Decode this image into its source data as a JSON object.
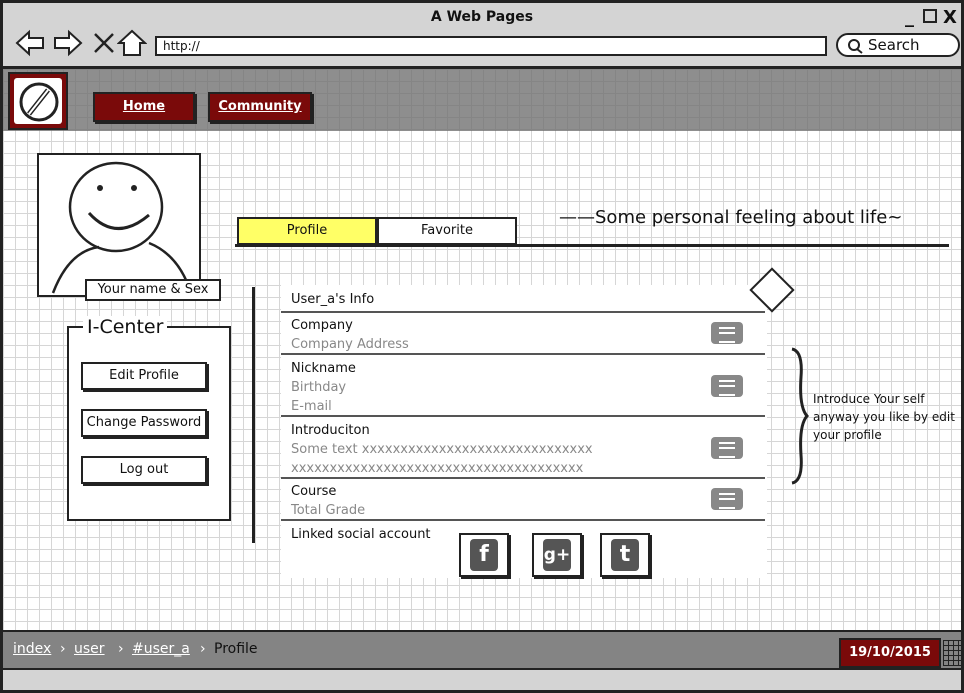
{
  "window": {
    "title": "A Web Pages"
  },
  "browser": {
    "url": "http://",
    "search_label": "Search"
  },
  "header": {
    "nav": [
      {
        "label": "Home"
      },
      {
        "label": "Community"
      }
    ]
  },
  "profile": {
    "name_label": "Your name & Sex",
    "tagline": "——Some personal feeling about life~"
  },
  "icenter": {
    "title": "I-Center",
    "buttons": [
      {
        "label": "Edit Profile"
      },
      {
        "label": "Change Password"
      },
      {
        "label": "Log out"
      }
    ]
  },
  "tabs": [
    {
      "label": "Profile",
      "active": true
    },
    {
      "label": "Favorite",
      "active": false
    }
  ],
  "info": {
    "header": "User_a's Info",
    "rows": [
      {
        "title": "Company",
        "subs": [
          "Company Address"
        ]
      },
      {
        "title": "Nickname",
        "subs": [
          "Birthday",
          "E-mail"
        ]
      },
      {
        "title": "Introduciton",
        "subs": [
          "Some text xxxxxxxxxxxxxxxxxxxxxxxxxxxxxx",
          "xxxxxxxxxxxxxxxxxxxxxxxxxxxxxxxxxxxxxx"
        ]
      },
      {
        "title": "Course",
        "subs": [
          "Total Grade"
        ]
      }
    ],
    "social_label": "Linked social account",
    "social": [
      {
        "icon": "facebook-icon",
        "glyph": "f"
      },
      {
        "icon": "google-plus-icon",
        "glyph": "g+"
      },
      {
        "icon": "twitter-icon",
        "glyph": "t"
      }
    ]
  },
  "annotation": "Introduce Your self anyway you like by edit your profile",
  "footer": {
    "breadcrumb": [
      "index",
      "user",
      "#user_a"
    ],
    "current": "Profile",
    "date": "19/10/2015"
  },
  "colors": {
    "accent": "#7a0a0a",
    "active_tab": "#ffff66",
    "band": "#6e6e6e"
  }
}
